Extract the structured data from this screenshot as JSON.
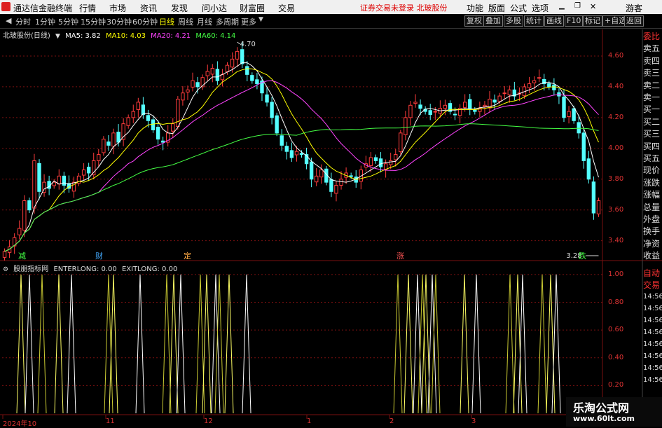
{
  "menubar": {
    "app_name": "通达信金融终端",
    "items": [
      "行情",
      "市场",
      "资讯",
      "发现",
      "问小达",
      "财富圈",
      "交易"
    ],
    "notice": "证券交易未登录  北玻股份",
    "right_items": [
      "功能",
      "版面",
      "公式",
      "选项"
    ],
    "user": "游客",
    "window_controls": [
      "minimize-icon",
      "restore-icon",
      "close-icon"
    ]
  },
  "toolbar": {
    "periods": [
      "分时",
      "1分钟",
      "5分钟",
      "15分钟",
      "30分钟",
      "60分钟",
      "日线",
      "周线",
      "月线",
      "多周期",
      "更多"
    ],
    "active_period": "日线",
    "right_buttons": [
      "复权",
      "叠加",
      "多股",
      "统计",
      "画线",
      "F10",
      "标记",
      "+自选",
      "返回"
    ]
  },
  "chart_header": {
    "stock": "北玻股份(日线)",
    "ma": [
      {
        "label": "MA5: 3.82",
        "color": "#ffffff"
      },
      {
        "label": "MA10: 4.03",
        "color": "#ffff00"
      },
      {
        "label": "MA20: 4.21",
        "color": "#ff44ff"
      },
      {
        "label": "MA60: 4.14",
        "color": "#44ff44"
      }
    ]
  },
  "indicator_header": {
    "name": "股朋指标网",
    "enter": "ENTERLONG: 0.00",
    "exit": "EXITLONG: 0.00"
  },
  "colors": {
    "up": "#ff3c3c",
    "down": "#54ffff",
    "ma5": "#ffffff",
    "ma10": "#ffff00",
    "ma20": "#ff44ff",
    "ma60": "#44ff44",
    "grid": "#7a1010",
    "axis": "#d33"
  },
  "price_axis": {
    "ticks": [
      "4.60",
      "4.40",
      "4.20",
      "4.00",
      "3.80",
      "3.60",
      "3.40"
    ]
  },
  "indicator_axis": {
    "ticks": [
      "1.00",
      "0.80",
      "0.60",
      "0.40",
      "0.20"
    ]
  },
  "x_axis": {
    "labels": [
      "2024年10",
      "11",
      "12",
      "1",
      "2",
      "3"
    ]
  },
  "annotations": {
    "high": "4.70",
    "low": "3.28"
  },
  "event_marks": [
    {
      "text": "减",
      "color": "#4f4"
    },
    {
      "text": "财",
      "color": "#4af"
    },
    {
      "text": "定",
      "color": "#fa4"
    },
    {
      "text": "涨",
      "color": "#f55"
    },
    {
      "text": "跌",
      "color": "#4f4"
    }
  ],
  "right_panel": {
    "rows": [
      "委比",
      "卖五",
      "卖四",
      "卖三",
      "卖二",
      "卖一",
      "买一",
      "买二",
      "买三",
      "买四",
      "买五",
      "现价",
      "涨跌",
      "涨幅",
      "总量",
      "外盘",
      "换手",
      "净资",
      "收益"
    ],
    "lower": [
      "自动",
      "交易",
      "14:56",
      "14:56",
      "14:56",
      "14:56",
      "14:56",
      "14:56",
      "14:56",
      "14:56"
    ]
  },
  "watermark": {
    "line1": "乐淘公式网",
    "line2": "www.60lt.com"
  },
  "chart_data": {
    "type": "candlestick",
    "closes": [
      3.33,
      3.36,
      3.42,
      3.48,
      3.66,
      3.6,
      3.92,
      3.72,
      3.78,
      3.74,
      3.78,
      3.82,
      3.76,
      3.74,
      3.78,
      3.82,
      3.86,
      3.84,
      3.92,
      3.96,
      4.06,
      4.02,
      4.1,
      4.04,
      4.16,
      4.2,
      4.24,
      4.3,
      4.22,
      4.18,
      4.12,
      4.06,
      4.04,
      4.1,
      4.16,
      4.32,
      4.36,
      4.38,
      4.44,
      4.4,
      4.46,
      4.5,
      4.52,
      4.44,
      4.48,
      4.54,
      4.58,
      4.63,
      4.55,
      4.48,
      4.44,
      4.42,
      4.36,
      4.3,
      4.2,
      4.1,
      4.02,
      3.98,
      3.94,
      3.98,
      3.96,
      3.9,
      3.8,
      3.82,
      3.86,
      3.78,
      3.72,
      3.76,
      3.8,
      3.84,
      3.82,
      3.78,
      3.86,
      3.9,
      3.94,
      3.92,
      3.88,
      3.9,
      3.92,
      3.96,
      4.1,
      4.2,
      4.28,
      4.3,
      4.26,
      4.24,
      4.22,
      4.24,
      4.26,
      4.28,
      4.24,
      4.22,
      4.26,
      4.3,
      4.26,
      4.24,
      4.26,
      4.28,
      4.32,
      4.3,
      4.34,
      4.36,
      4.38,
      4.34,
      4.36,
      4.4,
      4.42,
      4.44,
      4.46,
      4.42,
      4.4,
      4.38,
      4.34,
      4.2,
      4.24,
      4.18,
      4.1,
      3.92,
      3.8,
      3.58,
      3.66
    ],
    "ma": {
      "MA5": 3.82,
      "MA10": 4.03,
      "MA20": 4.21,
      "MA60": 4.14
    },
    "ylim": [
      3.28,
      4.7
    ],
    "indicator": {
      "name": "ENTERLONG/EXITLONG",
      "ylim": [
        0,
        1.05
      ]
    }
  }
}
